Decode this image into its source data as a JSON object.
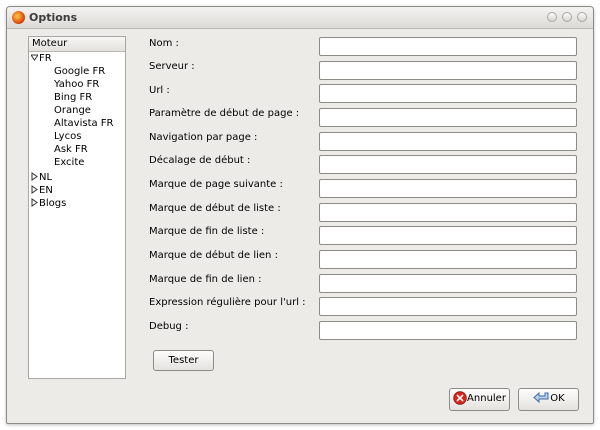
{
  "window": {
    "title": "Options"
  },
  "tree": {
    "header": "Moteur",
    "fr": {
      "label": "FR",
      "children": [
        "Google FR",
        "Yahoo FR",
        "Bing FR",
        "Orange",
        "Altavista FR",
        "Lycos",
        "Ask FR",
        "Excite"
      ]
    },
    "nl": {
      "label": "NL"
    },
    "en": {
      "label": "EN"
    },
    "blogs": {
      "label": "Blogs"
    }
  },
  "form": {
    "fields": [
      {
        "label": "Nom :",
        "value": ""
      },
      {
        "label": "Serveur :",
        "value": ""
      },
      {
        "label": "Url :",
        "value": ""
      },
      {
        "label": "Paramètre de début de page :",
        "value": ""
      },
      {
        "label": "Navigation par page :",
        "value": ""
      },
      {
        "label": "Décalage de début :",
        "value": ""
      },
      {
        "label": "Marque de page suivante :",
        "value": ""
      },
      {
        "label": "Marque de début de liste :",
        "value": ""
      },
      {
        "label": "Marque de fin de liste :",
        "value": ""
      },
      {
        "label": "Marque de début de lien :",
        "value": ""
      },
      {
        "label": "Marque de fin de lien :",
        "value": ""
      },
      {
        "label": "Expression régulière pour l'url :",
        "value": ""
      },
      {
        "label": "Debug :",
        "value": ""
      }
    ],
    "test_button": "Tester"
  },
  "footer": {
    "cancel_label": "Annuler",
    "ok_label": "OK"
  },
  "icons": {
    "cancel": "cancel-icon",
    "ok": "ok-arrow-icon",
    "app": "firefox-icon"
  }
}
